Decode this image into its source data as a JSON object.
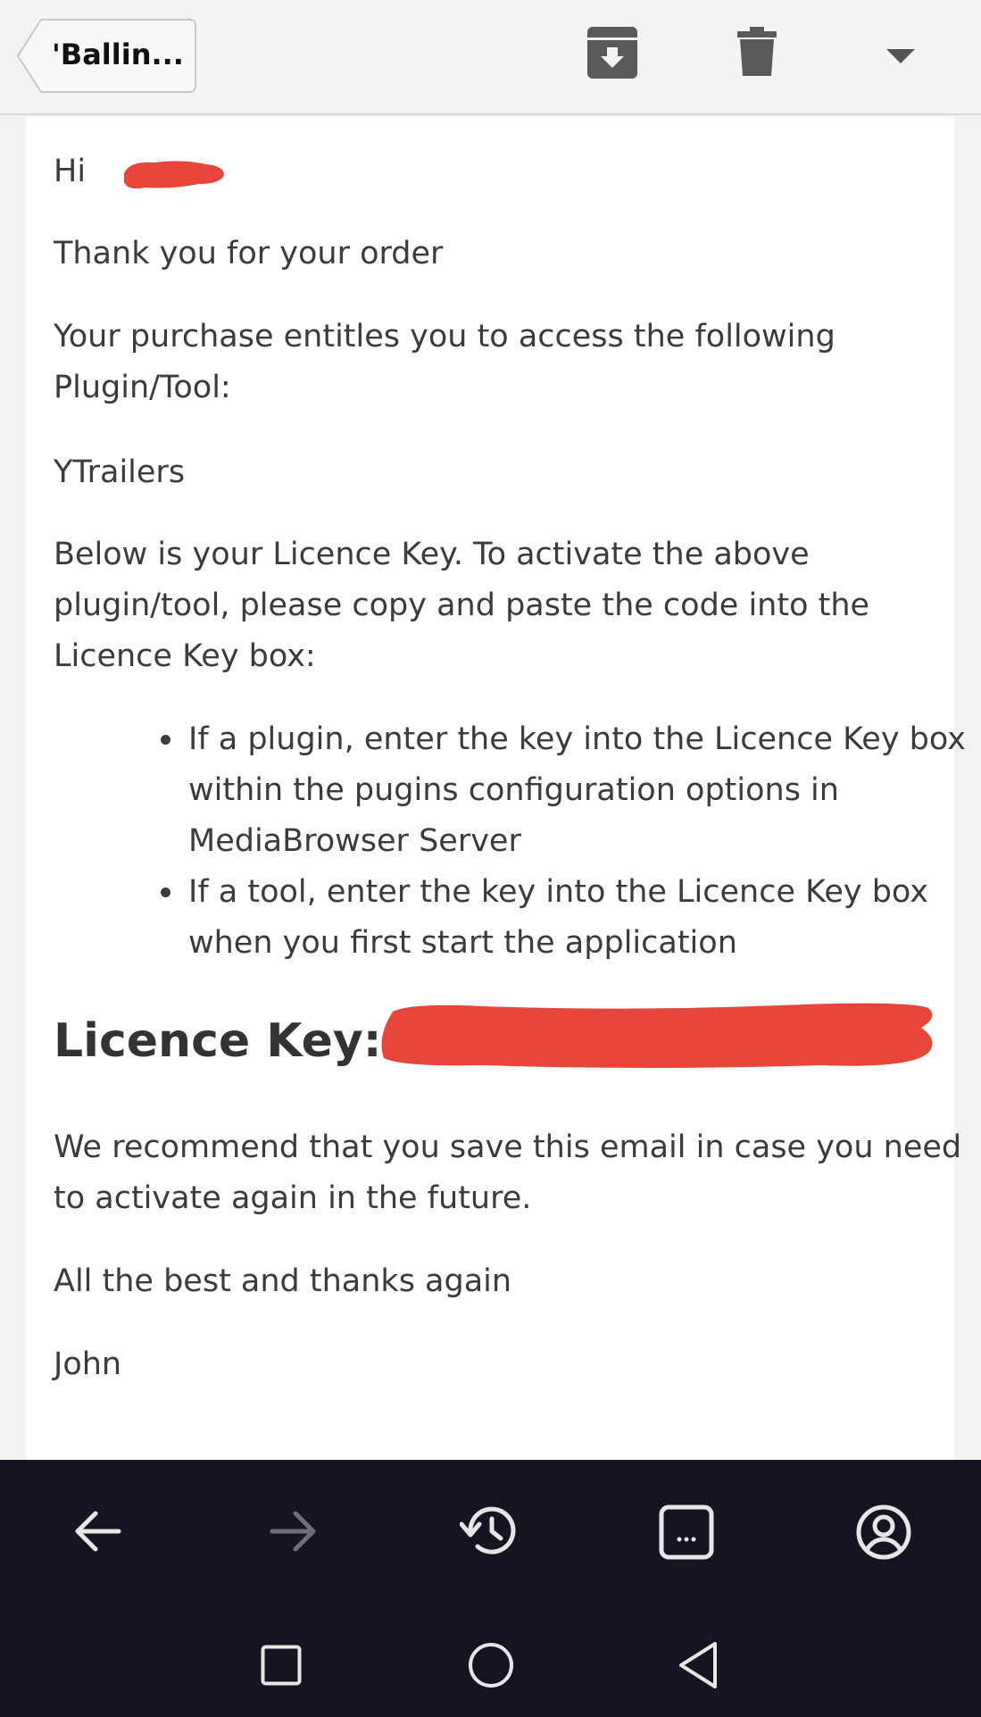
{
  "toolbar": {
    "back_label": "'Ballin...",
    "icons": [
      "archive-icon",
      "trash-icon",
      "dropdown-caret-icon"
    ]
  },
  "email": {
    "greeting": "Hi",
    "thanks": "Thank you for your order",
    "entitles_line1": "Your purchase entitles you to access the following",
    "entitles_line2": "Plugin/Tool:",
    "product": "YTrailers",
    "below_line1": "Below is your Licence Key. To activate the above",
    "below_line2": "plugin/tool, please copy and paste the code into the",
    "below_line3": "Licence Key box:",
    "bullet1_line1": "If a plugin, enter the key into the Licence Key box",
    "bullet1_line2": "within the pugins configuration options in",
    "bullet1_line3": "MediaBrowser Server",
    "bullet2_line1": "If a tool, enter the key into the Licence Key box",
    "bullet2_line2": "when you first start the application",
    "licence_label": "Licence Key:",
    "recommend_line1": "We recommend that you save this email in case you need",
    "recommend_line2": "to activate again in the future.",
    "closing": "All the best and thanks again",
    "signature": "John"
  },
  "colors": {
    "redaction": "#e8453a",
    "browser_bar": "#141521",
    "text": "#3b3b3b"
  },
  "browser_bar": {
    "icons": [
      "back-arrow-icon",
      "forward-arrow-icon",
      "history-icon",
      "tabs-icon",
      "account-icon"
    ]
  },
  "system_nav": {
    "icons": [
      "recents-square-icon",
      "home-circle-icon",
      "back-triangle-icon"
    ]
  }
}
